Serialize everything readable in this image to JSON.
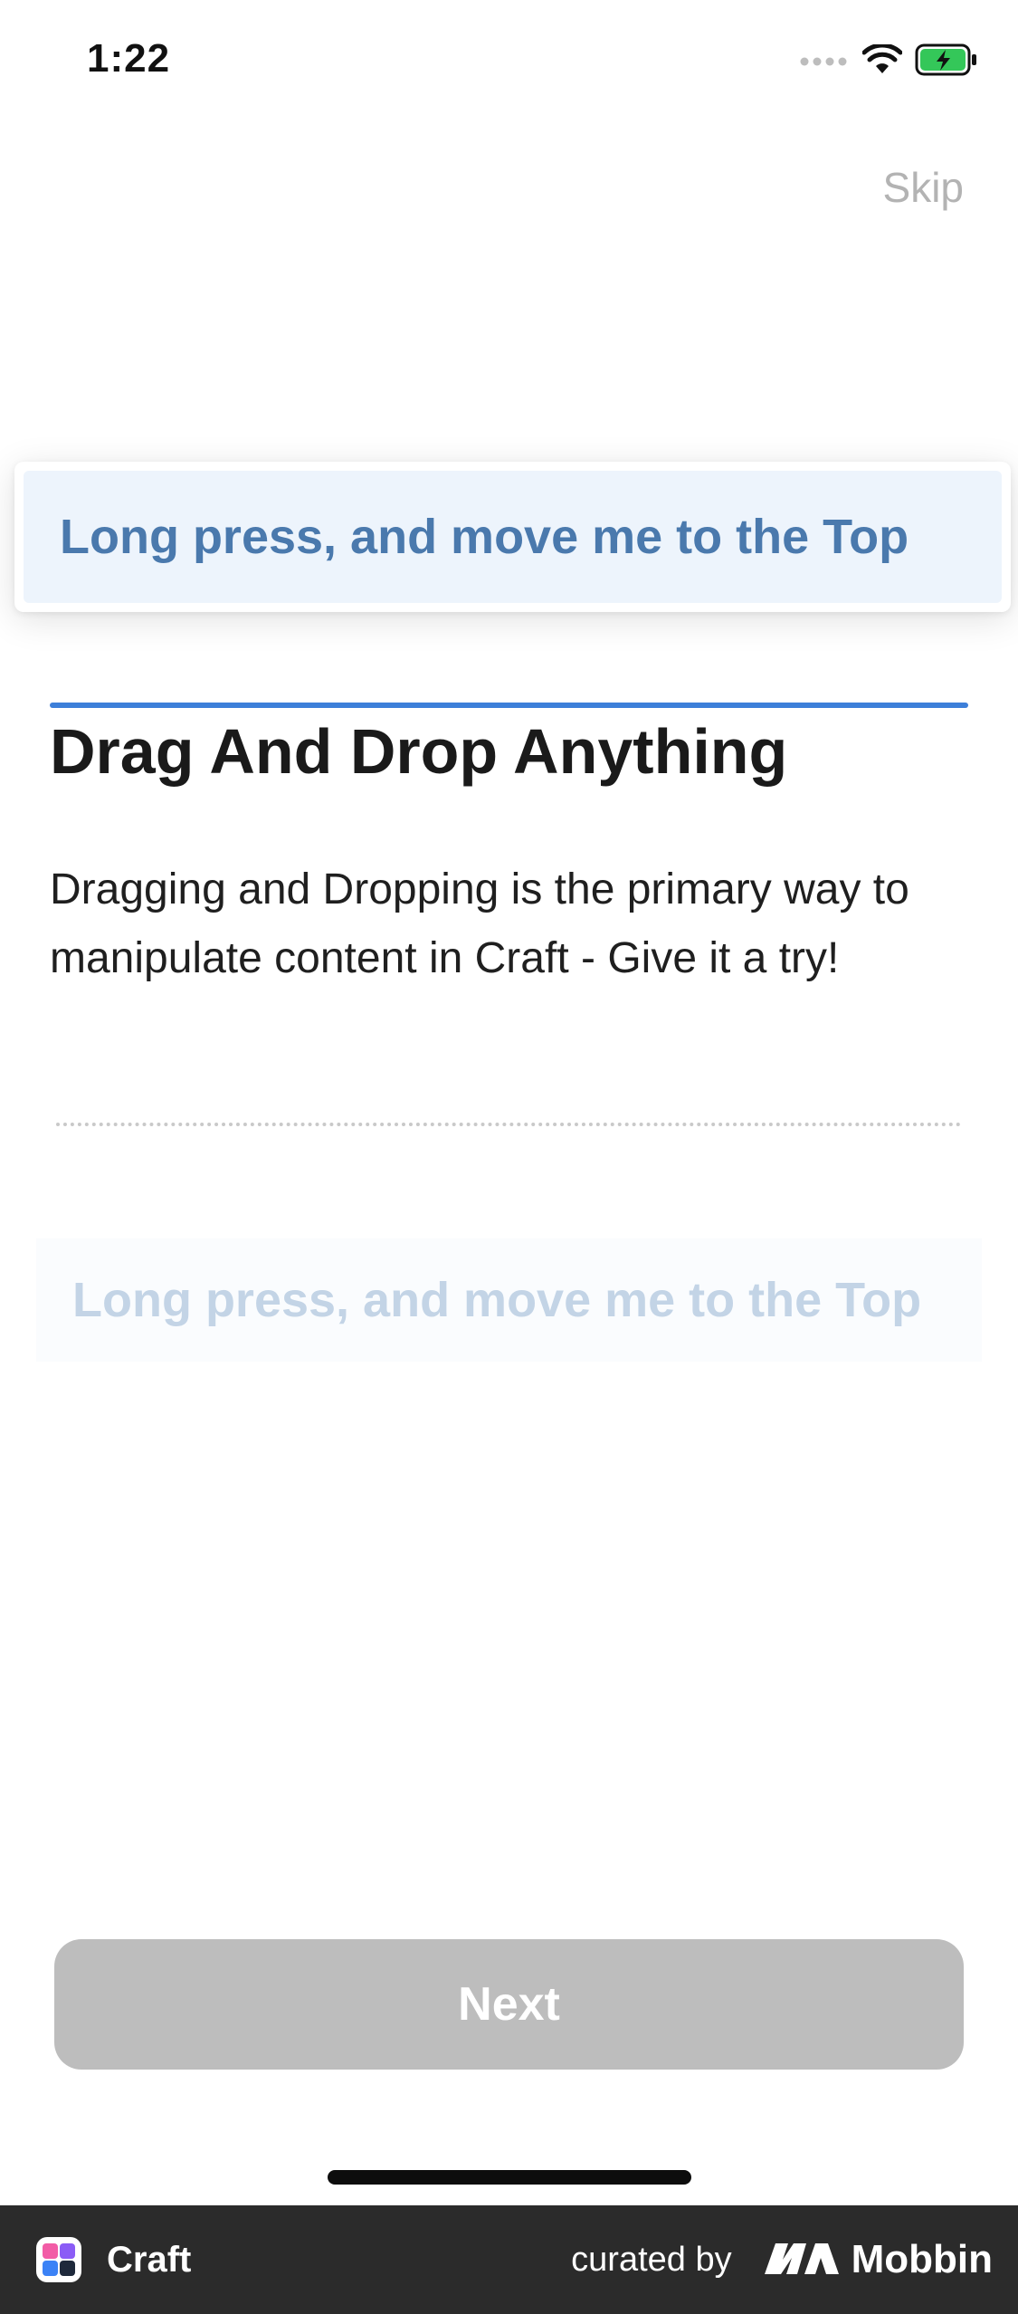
{
  "status_bar": {
    "time": "1:22",
    "icons": [
      "cellular-signal-icon",
      "wifi-icon",
      "battery-charging-icon"
    ],
    "battery_color": "#34c759"
  },
  "header": {
    "skip_label": "Skip"
  },
  "drag_card": {
    "text": "Long press, and move me to the Top"
  },
  "content": {
    "heading": "Drag And Drop Anything",
    "body": "Dragging and Dropping is the primary way to manipulate content in Craft - Give it a try!"
  },
  "ghost_block": {
    "text": "Long press, and move me to the Top"
  },
  "footer": {
    "next_label": "Next"
  },
  "brand_bar": {
    "app_name": "Craft",
    "curated_label": "curated by",
    "brand_name": "Mobbin"
  },
  "colors": {
    "accent": "#3d7fd9",
    "card_text": "#4a79ad",
    "card_background": "#edf4fc",
    "button_disabled": "#bdbdbd",
    "skip_text": "#b3b3b3",
    "brand_bar": "#2b2b2b"
  }
}
